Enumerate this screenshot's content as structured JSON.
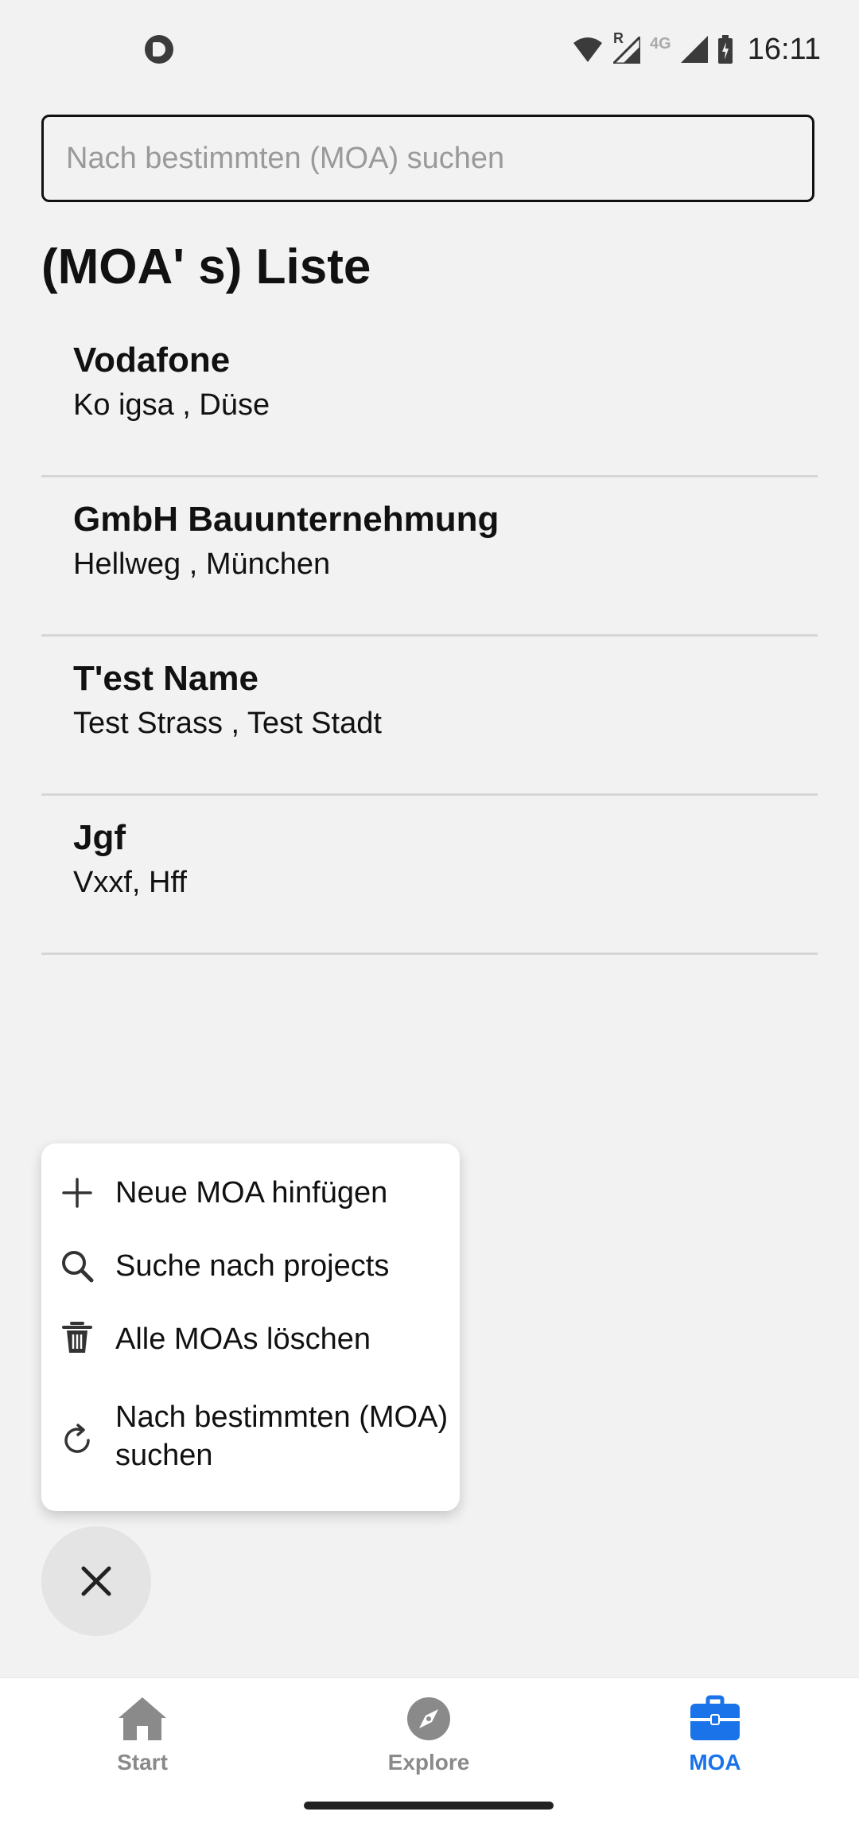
{
  "status_bar": {
    "time": "16:11",
    "network": "4G",
    "roaming": "R"
  },
  "search": {
    "placeholder": "Nach bestimmten (MOA) suchen",
    "value": ""
  },
  "page": {
    "title": "(MOA' s) Liste"
  },
  "list_items": [
    {
      "title": "Vodafone",
      "subtitle": "Ko igsa , Düse"
    },
    {
      "title": "GmbH Bauunternehmung",
      "subtitle": "Hellweg , München"
    },
    {
      "title": "T'est Name",
      "subtitle": "Test Strass , Test Stadt"
    },
    {
      "title": "Jgf",
      "subtitle": "Vxxf, Hff"
    }
  ],
  "menu": {
    "items": [
      {
        "label": "Neue MOA hinfügen",
        "icon": "plus-icon"
      },
      {
        "label": "Suche nach projects",
        "icon": "search-icon"
      },
      {
        "label": "Alle MOAs löschen",
        "icon": "trash-icon"
      },
      {
        "label": "Nach bestimmten (MOA) suchen",
        "icon": "refresh-icon"
      }
    ]
  },
  "fab": {
    "icon": "close-icon"
  },
  "bottom_nav": {
    "items": [
      {
        "label": "Start",
        "icon": "home-icon",
        "active": false
      },
      {
        "label": "Explore",
        "icon": "compass-icon",
        "active": false
      },
      {
        "label": "MOA",
        "icon": "briefcase-icon",
        "active": true
      }
    ]
  },
  "colors": {
    "accent": "#1a73e8",
    "inactive": "#8a8a8a",
    "background": "#f2f2f2"
  }
}
